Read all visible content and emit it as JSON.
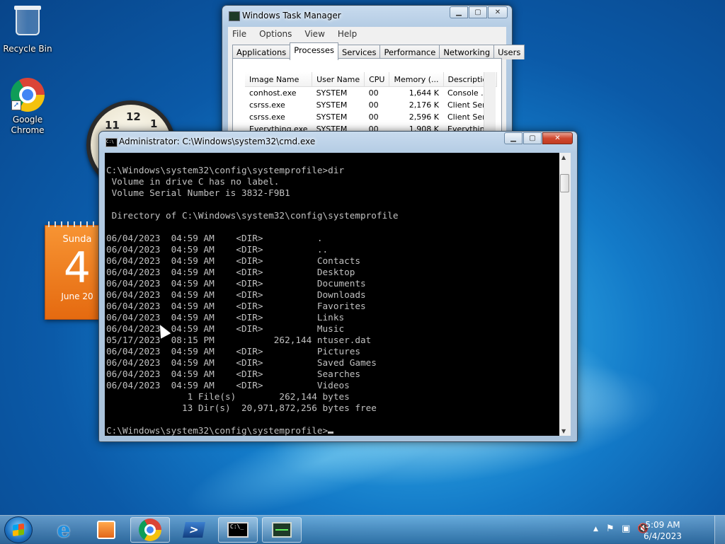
{
  "desktop": {
    "icons": [
      {
        "label": "Recycle Bin"
      },
      {
        "label": "Google\nChrome"
      }
    ]
  },
  "gadgets": {
    "clock": {
      "numerals": [
        "12",
        "1",
        "11"
      ]
    },
    "calendar": {
      "day": "Sunda",
      "date": "4",
      "month": "June 20"
    }
  },
  "task_manager": {
    "title": "Windows Task Manager",
    "menu": [
      "File",
      "Options",
      "View",
      "Help"
    ],
    "tabs": [
      "Applications",
      "Processes",
      "Services",
      "Performance",
      "Networking",
      "Users"
    ],
    "active_tab": "Processes",
    "columns": [
      "Image Name",
      "User Name",
      "CPU",
      "Memory (...",
      "Description"
    ],
    "rows": [
      [
        "conhost.exe",
        "SYSTEM",
        "00",
        "1,644 K",
        "Console ..."
      ],
      [
        "csrss.exe",
        "SYSTEM",
        "00",
        "2,176 K",
        "Client Ser..."
      ],
      [
        "csrss.exe",
        "SYSTEM",
        "00",
        "2,596 K",
        "Client Ser..."
      ],
      [
        "Everything.exe",
        "SYSTEM",
        "00",
        "1,908 K",
        "Everything"
      ]
    ]
  },
  "cmd": {
    "title": "Administrator: C:\\Windows\\system32\\cmd.exe",
    "icon_text": "C:\\",
    "prompt": "C:\\Windows\\system32\\config\\systemprofile>",
    "lines": [
      "C:\\Windows\\system32\\config\\systemprofile>dir",
      " Volume in drive C has no label.",
      " Volume Serial Number is 3832-F9B1",
      "",
      " Directory of C:\\Windows\\system32\\config\\systemprofile",
      "",
      "06/04/2023  04:59 AM    <DIR>          .",
      "06/04/2023  04:59 AM    <DIR>          ..",
      "06/04/2023  04:59 AM    <DIR>          Contacts",
      "06/04/2023  04:59 AM    <DIR>          Desktop",
      "06/04/2023  04:59 AM    <DIR>          Documents",
      "06/04/2023  04:59 AM    <DIR>          Downloads",
      "06/04/2023  04:59 AM    <DIR>          Favorites",
      "06/04/2023  04:59 AM    <DIR>          Links",
      "06/04/2023  04:59 AM    <DIR>          Music",
      "05/17/2023  08:15 PM           262,144 ntuser.dat",
      "06/04/2023  04:59 AM    <DIR>          Pictures",
      "06/04/2023  04:59 AM    <DIR>          Saved Games",
      "06/04/2023  04:59 AM    <DIR>          Searches",
      "06/04/2023  04:59 AM    <DIR>          Videos",
      "               1 File(s)        262,144 bytes",
      "              13 Dir(s)  20,971,872,256 bytes free",
      ""
    ]
  },
  "taskbar": {
    "icons": [
      "windows-start-icon",
      "internet-explorer-icon",
      "media-player-icon",
      "chrome-icon",
      "powershell-icon",
      "cmd-icon",
      "task-manager-icon"
    ],
    "cmd_icon_text": "C:\\_",
    "ie_glyph": "e",
    "ps_glyph": ">",
    "tray": {
      "time": "5:09 AM",
      "date": "6/4/2023",
      "up_arrow": "▲",
      "flag": "⚑",
      "network": "▣",
      "volume": "🔇"
    }
  }
}
